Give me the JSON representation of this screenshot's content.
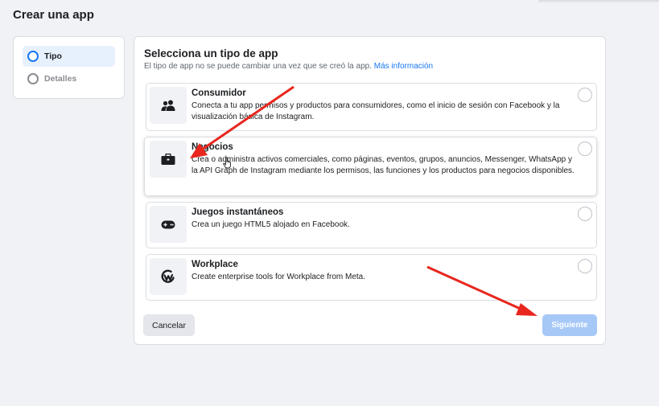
{
  "page": {
    "title": "Crear una app"
  },
  "stepper": {
    "steps": [
      {
        "label": "Tipo",
        "active": true
      },
      {
        "label": "Detalles",
        "active": false
      }
    ]
  },
  "main": {
    "title": "Selecciona un tipo de app",
    "subtitle": "El tipo de app no se puede cambiar una vez que se creó la app.",
    "subtitle_link": "Más información",
    "options": [
      {
        "title": "Consumidor",
        "description": "Conecta a tu app permisos y productos para consumidores, como el inicio de sesión con Facebook y la visualización básica de Instagram.",
        "icon": "people-icon"
      },
      {
        "title": "Negocios",
        "description": "Crea o administra activos comerciales, como páginas, eventos, grupos, anuncios, Messenger, WhatsApp y la API Graph de Instagram mediante los permisos, las funciones y los productos para negocios disponibles.",
        "icon": "briefcase-icon"
      },
      {
        "title": "Juegos instantáneos",
        "description": "Crea un juego HTML5 alojado en Facebook.",
        "icon": "gamepad-icon"
      },
      {
        "title": "Workplace",
        "description": "Create enterprise tools for Workplace from Meta.",
        "icon": "workplace-icon"
      }
    ],
    "cancel_label": "Cancelar",
    "next_label": "Siguiente"
  },
  "colors": {
    "accent": "#1877f2",
    "disabled_button": "#a6c8f7",
    "annotation_arrow": "#e8261d"
  }
}
